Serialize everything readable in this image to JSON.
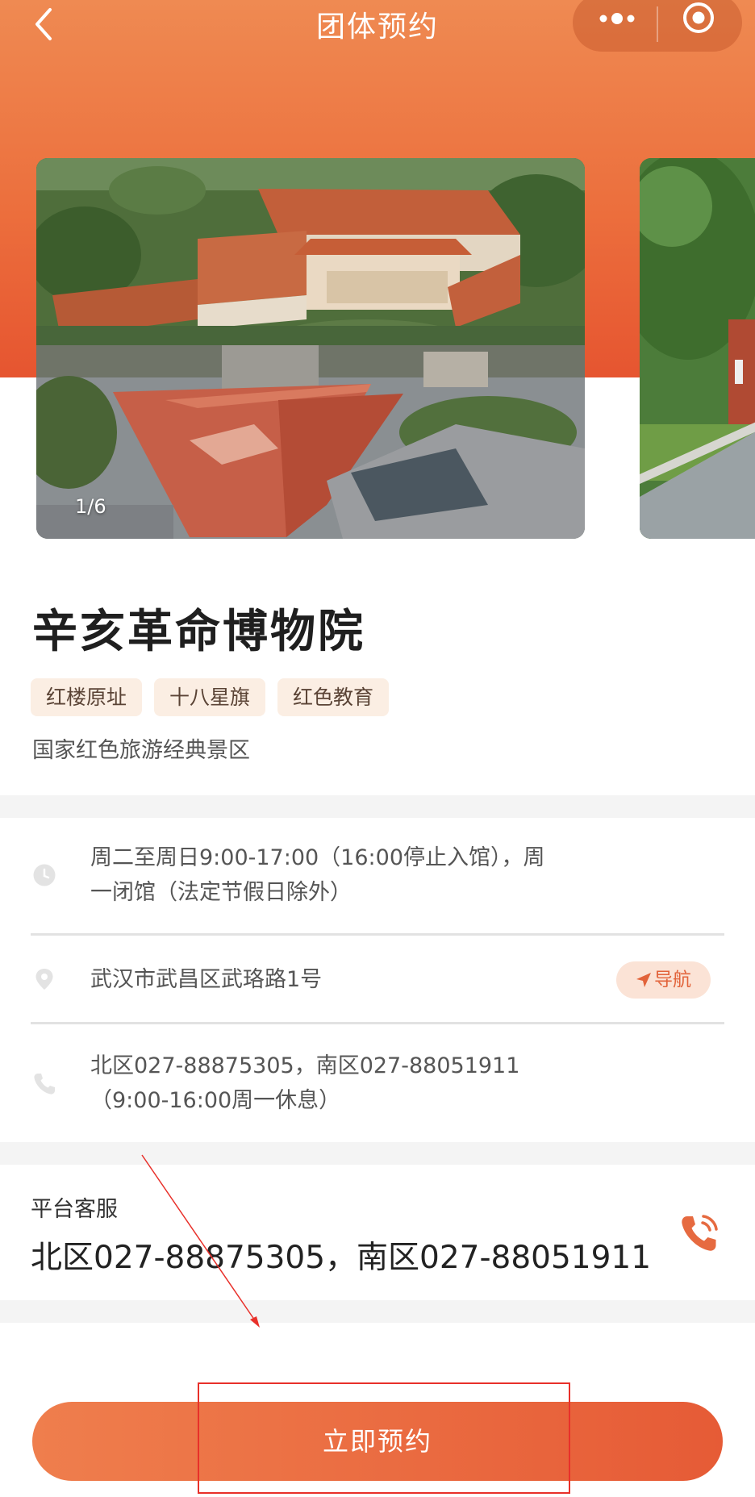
{
  "header": {
    "title": "团体预约",
    "back_icon": "chevron-left-icon",
    "more_icon": "more-dots-icon",
    "close_icon": "target-circle-icon"
  },
  "carousel": {
    "counter": "1/6"
  },
  "venue": {
    "name": "辛亥革命博物院",
    "tags": [
      "红楼原址",
      "十八星旗",
      "红色教育"
    ],
    "subtitle": "国家红色旅游经典景区"
  },
  "info": {
    "hours_line1": "周二至周日9:00-17:00（16:00停止入馆），周",
    "hours_line2": "一闭馆（法定节假日除外）",
    "address": "武汉市武昌区武珞路1号",
    "navigate_label": "导航",
    "phone_line1": "北区027-88875305，南区027-88051911",
    "phone_line2": "（9:00-16:00周一休息）"
  },
  "customer_service": {
    "label": "平台客服",
    "phone": "北区027-88875305，南区027-88051911"
  },
  "footer": {
    "book_label": "立即预约"
  },
  "colors": {
    "brand_orange": "#ec6f3d",
    "tag_bg": "#fbeee3",
    "annotation_red": "#e8302a"
  }
}
